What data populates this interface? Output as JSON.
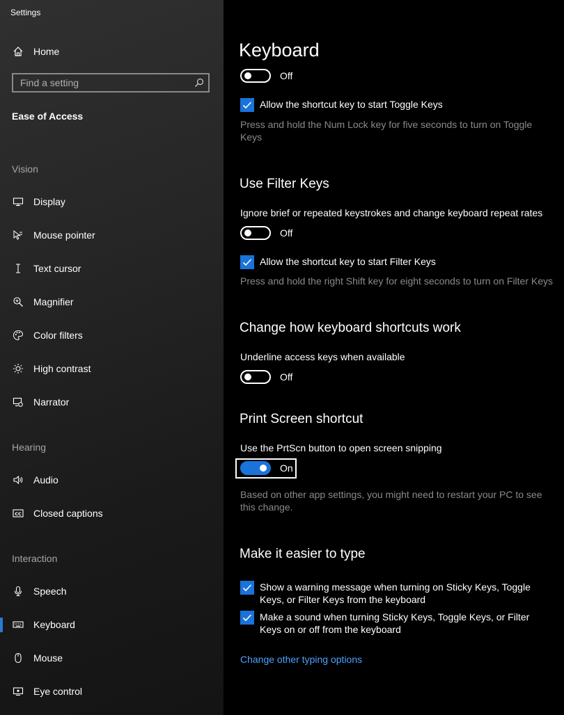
{
  "app": {
    "title": "Settings"
  },
  "sidebar": {
    "home": "Home",
    "search_placeholder": "Find a setting",
    "group": "Ease of Access",
    "vision_label": "Vision",
    "vision": [
      "Display",
      "Mouse pointer",
      "Text cursor",
      "Magnifier",
      "Color filters",
      "High contrast",
      "Narrator"
    ],
    "hearing_label": "Hearing",
    "hearing": [
      "Audio",
      "Closed captions"
    ],
    "interaction_label": "Interaction",
    "interaction": [
      "Speech",
      "Keyboard",
      "Mouse",
      "Eye control"
    ],
    "active_item": "Keyboard"
  },
  "main": {
    "title": "Keyboard",
    "toggle_keys": {
      "toggle_state": "Off",
      "shortcut_label": "Allow the shortcut key to start Toggle Keys",
      "shortcut_checked": true,
      "hint": "Press and hold the Num Lock key for five seconds to turn on Toggle Keys"
    },
    "filter_keys": {
      "heading": "Use Filter Keys",
      "desc": "Ignore brief or repeated keystrokes and change keyboard repeat rates",
      "toggle_state": "Off",
      "shortcut_label": "Allow the shortcut key to start Filter Keys",
      "shortcut_checked": true,
      "hint": "Press and hold the right Shift key for eight seconds to turn on Filter Keys"
    },
    "shortcuts": {
      "heading": "Change how keyboard shortcuts work",
      "desc": "Underline access keys when available",
      "toggle_state": "Off"
    },
    "print_screen": {
      "heading": "Print Screen shortcut",
      "desc": "Use the PrtScn button to open screen snipping",
      "toggle_state": "On",
      "hint": "Based on other app settings, you might need to restart your PC to see this change."
    },
    "easier_typing": {
      "heading": "Make it easier to type",
      "warning_label": "Show a warning message when turning on Sticky Keys, Toggle Keys, or Filter Keys from the keyboard",
      "warning_checked": true,
      "sound_label": "Make a sound when turning Sticky Keys, Toggle Keys, or Filter Keys on or off from the keyboard",
      "sound_checked": true,
      "link": "Change other typing options"
    }
  },
  "colors": {
    "accent": "#1a73d9",
    "link": "#4aa3ff",
    "hint": "#8a8a8a"
  }
}
